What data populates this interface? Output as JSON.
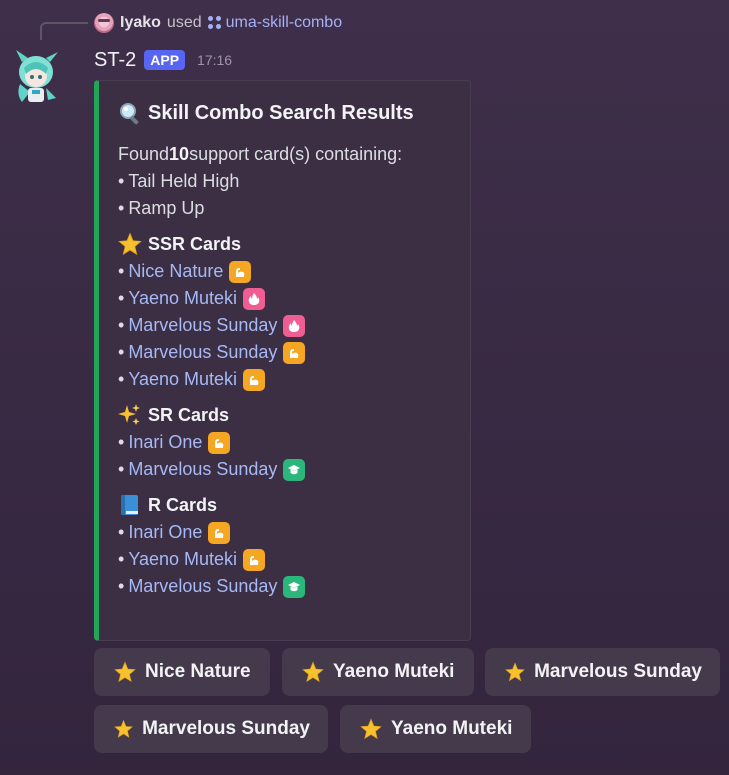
{
  "reply": {
    "user": "Iyako",
    "verb": "used",
    "command": "uma-skill-combo"
  },
  "message": {
    "bot_name": "ST-2",
    "badge": "APP",
    "time": "17:16"
  },
  "embed": {
    "accent": "#23a559",
    "title": "Skill Combo Search Results",
    "found_prefix": "Found ",
    "found_count": "10",
    "found_suffix": " support card(s) containing:",
    "skills": [
      "Tail Held High",
      "Ramp Up"
    ],
    "sections": [
      {
        "title": "SSR Cards",
        "icon": "star-emoji",
        "cards": [
          {
            "name": "Nice Nature",
            "type": "power"
          },
          {
            "name": "Yaeno Muteki",
            "type": "guts"
          },
          {
            "name": "Marvelous Sunday",
            "type": "guts"
          },
          {
            "name": "Marvelous Sunday",
            "type": "power"
          },
          {
            "name": "Yaeno Muteki",
            "type": "power"
          }
        ]
      },
      {
        "title": "SR Cards",
        "icon": "sparkles-emoji",
        "cards": [
          {
            "name": "Inari One",
            "type": "power"
          },
          {
            "name": "Marvelous Sunday",
            "type": "wit"
          }
        ]
      },
      {
        "title": "R Cards",
        "icon": "blue-book-emoji",
        "cards": [
          {
            "name": "Inari One",
            "type": "power"
          },
          {
            "name": "Yaeno Muteki",
            "type": "power"
          },
          {
            "name": "Marvelous Sunday",
            "type": "wit"
          }
        ]
      }
    ]
  },
  "buttons": [
    {
      "label": "Nice Nature"
    },
    {
      "label": "Yaeno Muteki"
    },
    {
      "label": "Marvelous Sunday"
    },
    {
      "label": "Marvelous Sunday"
    },
    {
      "label": "Yaeno Muteki"
    }
  ],
  "colors": {
    "power": "#f5a623",
    "guts": "#ef5d93",
    "wit": "#2bb67c",
    "link": "#a6b9f5",
    "badge": "#5865f2"
  }
}
